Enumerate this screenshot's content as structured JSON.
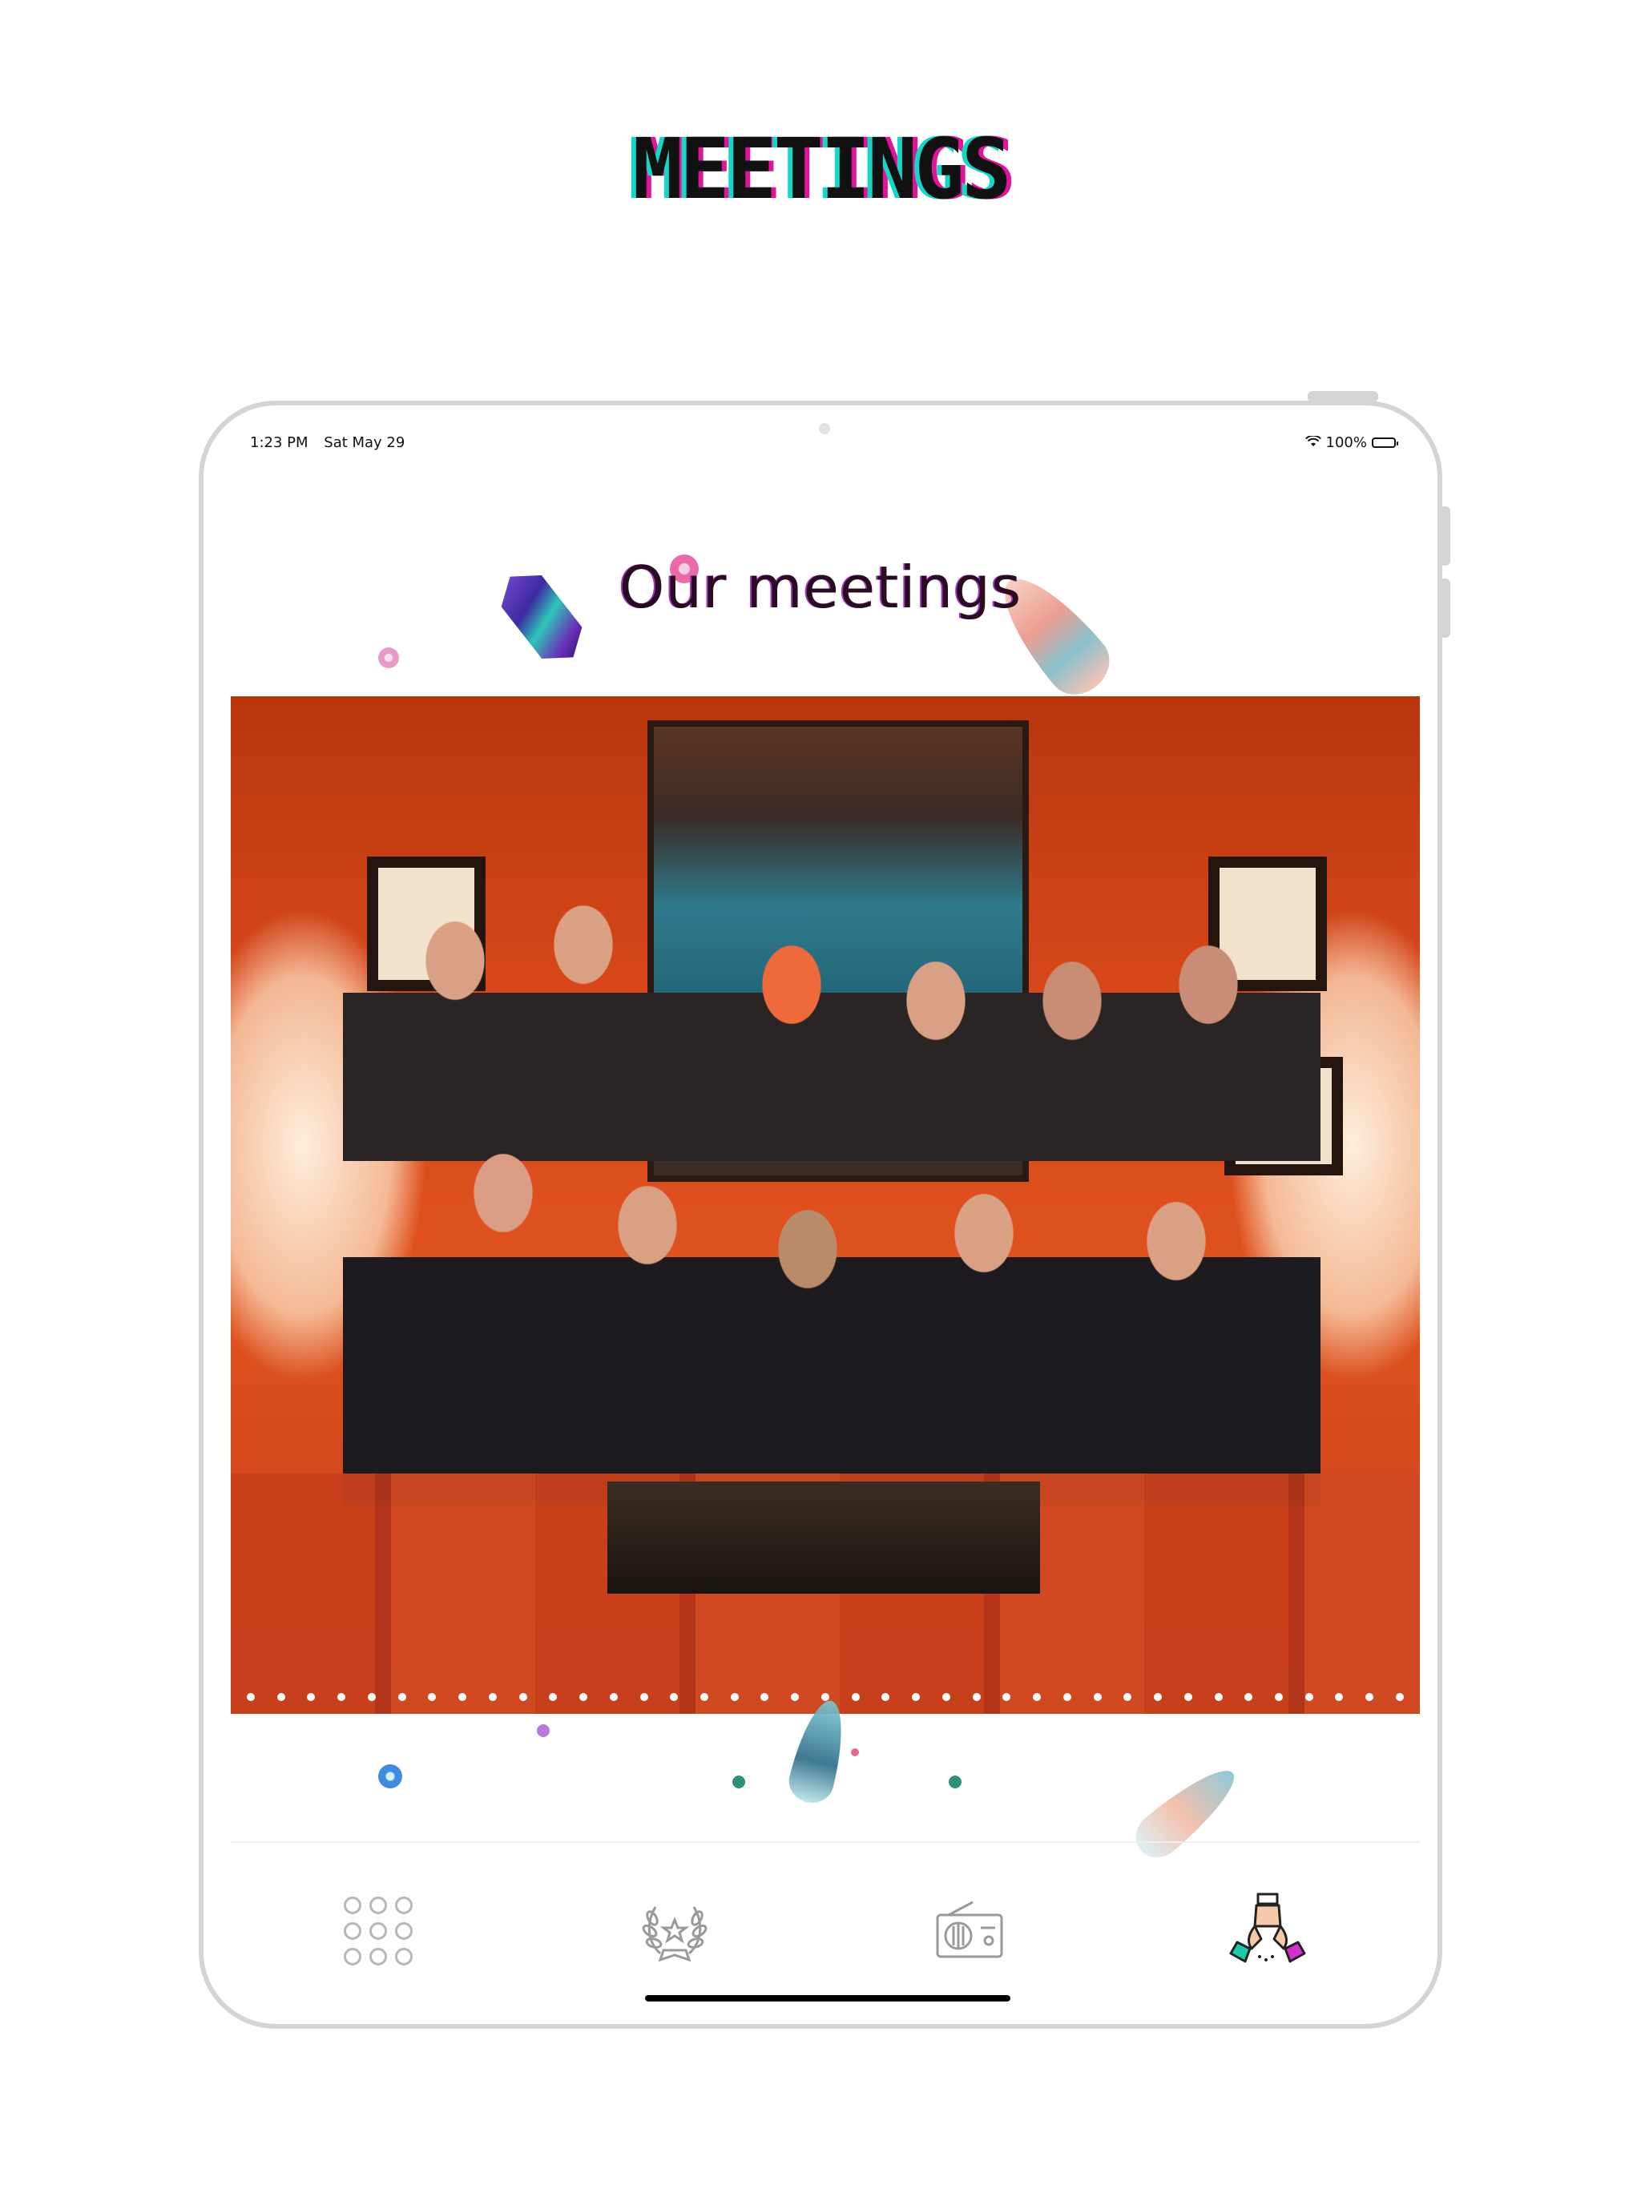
{
  "headline": "MEETINGS",
  "status_bar": {
    "time": "1:23 PM",
    "date": "Sat May 29",
    "battery": "100%"
  },
  "page_title": "Our meetings",
  "carousel": {
    "page_count": 39,
    "current_page": 1
  },
  "tab_bar": {
    "tabs": [
      {
        "name": "grid-menu",
        "icon": "grid-dots-icon",
        "selected": false
      },
      {
        "name": "awards",
        "icon": "laurel-wreath-icon",
        "selected": false
      },
      {
        "name": "radio",
        "icon": "radio-icon",
        "selected": false
      },
      {
        "name": "meetings",
        "icon": "holding-hands-icon",
        "selected": true
      }
    ]
  },
  "colors": {
    "accent_teal": "#16d6c8",
    "accent_magenta": "#e0149a",
    "title": "#2a0c22"
  }
}
